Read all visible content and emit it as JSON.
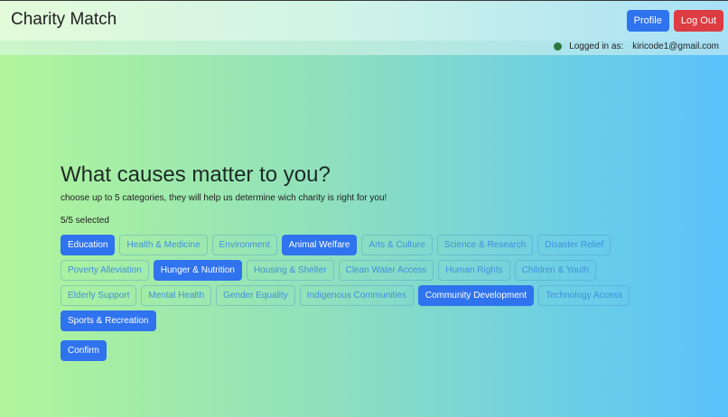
{
  "app": {
    "brand": "Charity Match"
  },
  "nav": {
    "profile_label": "Profile",
    "logout_label": "Log Out"
  },
  "login": {
    "label": "Logged in as:",
    "email": "kiricode1@gmail.com",
    "status_color": "#2e7a3e"
  },
  "main": {
    "title": "What causes matter to you?",
    "subtitle": "choose up to 5 categories, they will help us determine wich charity is right for you!",
    "counter": "5/5 selected",
    "confirm_label": "Confirm"
  },
  "categories": [
    {
      "label": "Education",
      "selected": true
    },
    {
      "label": "Health & Medicine",
      "selected": false
    },
    {
      "label": "Environment",
      "selected": false
    },
    {
      "label": "Animal Welfare",
      "selected": true
    },
    {
      "label": "Arts & Culture",
      "selected": false
    },
    {
      "label": "Science & Research",
      "selected": false
    },
    {
      "label": "Disaster Relief",
      "selected": false
    },
    {
      "label": "Poverty Alleviation",
      "selected": false
    },
    {
      "label": "Hunger & Nutrition",
      "selected": true
    },
    {
      "label": "Housing & Shelter",
      "selected": false
    },
    {
      "label": "Clean Water Access",
      "selected": false
    },
    {
      "label": "Human Rights",
      "selected": false
    },
    {
      "label": "Children & Youth",
      "selected": false
    },
    {
      "label": "Elderly Support",
      "selected": false
    },
    {
      "label": "Mental Health",
      "selected": false
    },
    {
      "label": "Gender Equality",
      "selected": false
    },
    {
      "label": "Indigenous Communities",
      "selected": false
    },
    {
      "label": "Community Development",
      "selected": true
    },
    {
      "label": "Technology Access",
      "selected": false
    },
    {
      "label": "Sports & Recreation",
      "selected": true
    }
  ],
  "colors": {
    "primary": "#2f73ee",
    "danger": "#dc3c42",
    "chip_text": "#3f8fdc"
  }
}
